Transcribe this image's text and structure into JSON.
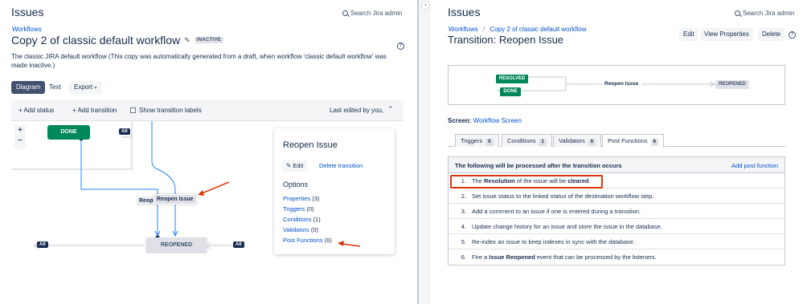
{
  "left": {
    "app_title": "Issues",
    "search_admin": "Search Jira admin",
    "breadcrumb": "Workflows",
    "workflow_title": "Copy 2 of classic default workflow",
    "status_badge": "INACTIVE",
    "description_line1": "The classic JIRA default workflow (This copy was automatically generated from a draft, when workflow 'classic default workflow' was",
    "description_line2": "made inactive.)",
    "view_tabs": [
      "Diagram",
      "Text",
      "Export"
    ],
    "toolbar": {
      "add_status": "Add status",
      "add_transition": "Add transition",
      "show_labels": "Show transition labels",
      "last_edited": "Last edited by you,"
    },
    "diagram": {
      "done_node": "DONE",
      "reopened_node": "REOPENED",
      "all_badge": "All",
      "transition_partial": "Reop",
      "transition_label": "Reopen Issue"
    },
    "popup": {
      "title": "Reopen Issue",
      "edit_label": "Edit",
      "delete_label": "Delete transition",
      "options_heading": "Options",
      "links": [
        {
          "label": "Properties",
          "count": "(3)"
        },
        {
          "label": "Triggers",
          "count": "(0)"
        },
        {
          "label": "Conditions",
          "count": "(1)"
        },
        {
          "label": "Validators",
          "count": "(0)"
        },
        {
          "label": "Post Functions",
          "count": "(6)"
        }
      ]
    },
    "accent_color": "#de350b"
  },
  "right": {
    "app_title": "Issues",
    "search_admin": "Search Jira admin",
    "breadcrumb_root": "Workflows",
    "breadcrumb_sep": "/",
    "breadcrumb_current": "Copy 2 of classic default workflow",
    "page_title": "Transition: Reopen Issue",
    "buttons": {
      "edit": "Edit",
      "view_properties": "View Properties",
      "delete": "Delete"
    },
    "diagram": {
      "from_resolved": "RESOLVED",
      "from_done": "DONE",
      "transition": "Reopen Issue",
      "to_status": "REOPENED"
    },
    "screen_label": "Screen:",
    "screen_value": "Workflow Screen",
    "tabs": [
      {
        "label": "Triggers",
        "count": "0"
      },
      {
        "label": "Conditions",
        "count": "1"
      },
      {
        "label": "Validators",
        "count": "0"
      },
      {
        "label": "Post Functions",
        "count": "6"
      }
    ],
    "table_heading": "The following will be processed after the transition occurs",
    "add_post_function": "Add post function",
    "post_functions": [
      {
        "num": "1.",
        "pre": "The ",
        "b1": "Resolution",
        "mid": " of the issue will be ",
        "b2": "cleared",
        "post": "."
      },
      {
        "num": "2.",
        "pre": "Set issue status to the linked status of the destination workflow step.",
        "b1": "",
        "mid": "",
        "b2": "",
        "post": ""
      },
      {
        "num": "3.",
        "pre": "Add a comment to an issue if one is entered during a transition.",
        "b1": "",
        "mid": "",
        "b2": "",
        "post": ""
      },
      {
        "num": "4.",
        "pre": "Update change history for an issue and store the issue in the database.",
        "b1": "",
        "mid": "",
        "b2": "",
        "post": ""
      },
      {
        "num": "5.",
        "pre": "Re-index an issue to keep indexes in sync with the database.",
        "b1": "",
        "mid": "",
        "b2": "",
        "post": ""
      },
      {
        "num": "6.",
        "pre": "Fire a ",
        "b1": "Issue Reopened",
        "mid": " event that can be processed by the listeners.",
        "b2": "",
        "post": ""
      }
    ]
  }
}
